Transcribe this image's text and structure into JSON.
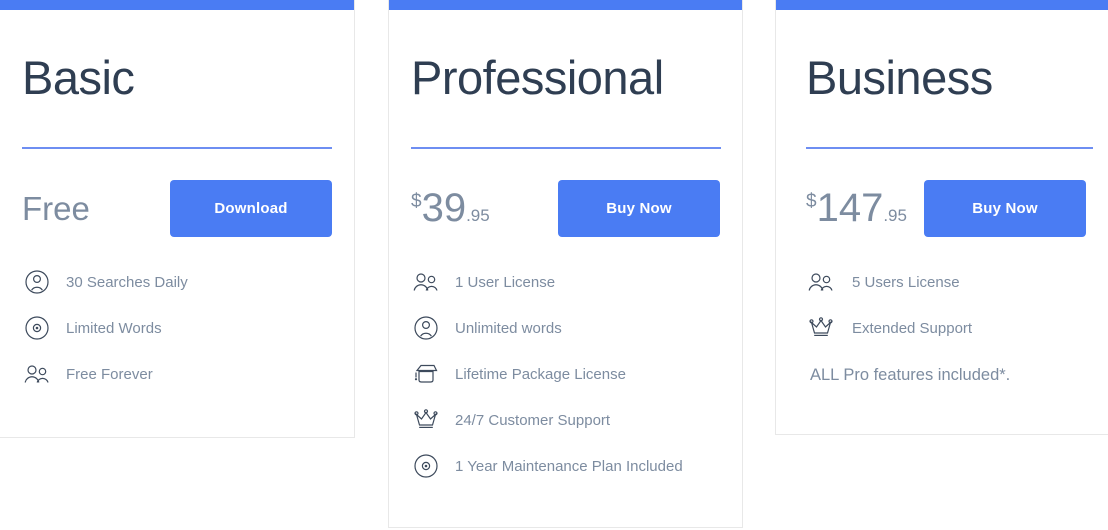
{
  "theme": {
    "accent": "#4a7cf3",
    "divider": "#6e8ef2",
    "title_color": "#2f3e52",
    "text_color": "#7d8ca0",
    "icon_color": "#3d4a5c",
    "card_border": "#e8e8e8",
    "background": "#ffffff"
  },
  "plans": [
    {
      "name": "Basic",
      "price": {
        "is_free": true,
        "free_label": "Free",
        "currency": "",
        "amount": "",
        "cents": ""
      },
      "cta_label": "Download",
      "features": [
        {
          "icon": "user-circle-icon",
          "label": "30 Searches Daily"
        },
        {
          "icon": "target-circle-icon",
          "label": "Limited Words"
        },
        {
          "icon": "users-group-icon",
          "label": "Free Forever"
        }
      ],
      "note": ""
    },
    {
      "name": "Professional",
      "price": {
        "is_free": false,
        "free_label": "",
        "currency": "$",
        "amount": "39",
        "cents": ".95"
      },
      "cta_label": "Buy Now",
      "features": [
        {
          "icon": "users-group-icon",
          "label": "1 User License"
        },
        {
          "icon": "user-circle-icon",
          "label": "Unlimited words"
        },
        {
          "icon": "package-box-icon",
          "label": "Lifetime Package License"
        },
        {
          "icon": "crown-icon",
          "label": "24/7 Customer Support"
        },
        {
          "icon": "target-circle-icon",
          "label": "1 Year Maintenance Plan Included"
        }
      ],
      "note": ""
    },
    {
      "name": "Business",
      "price": {
        "is_free": false,
        "free_label": "",
        "currency": "$",
        "amount": "147",
        "cents": ".95"
      },
      "cta_label": "Buy Now",
      "features": [
        {
          "icon": "users-group-icon",
          "label": "5 Users License"
        },
        {
          "icon": "crown-icon",
          "label": "Extended Support"
        }
      ],
      "note": "ALL Pro features included*."
    }
  ]
}
